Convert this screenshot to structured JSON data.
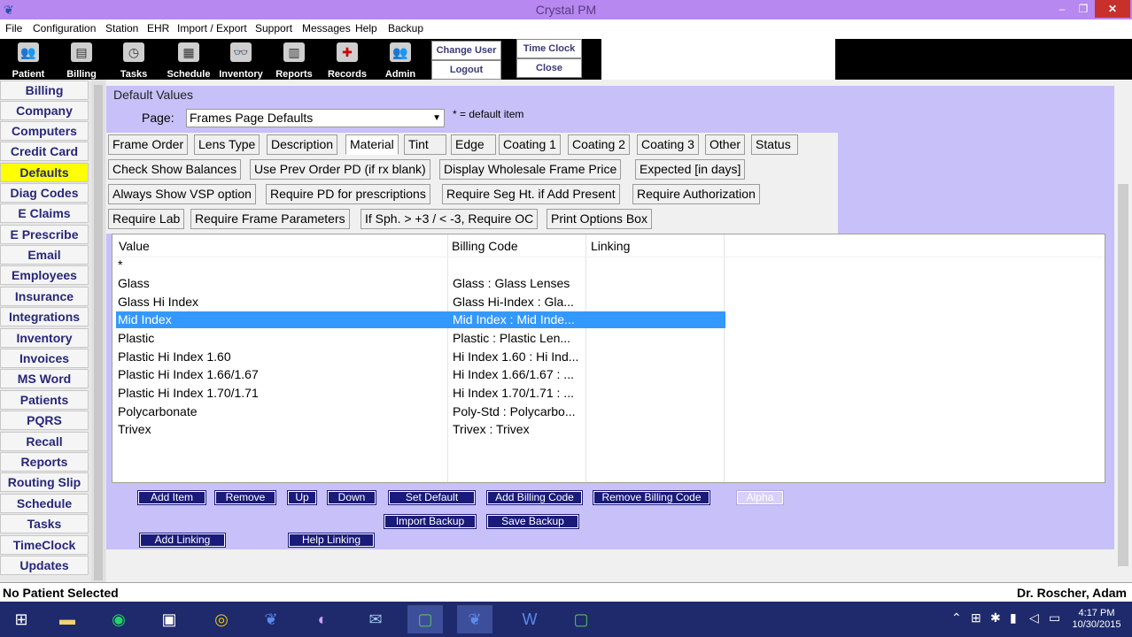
{
  "window": {
    "title": "Crystal PM",
    "minimize": "–",
    "maximize": "❐",
    "close": "✕"
  },
  "menu": [
    "File",
    "Configuration",
    "Station",
    "EHR",
    "Import / Export",
    "Support",
    "Messages",
    "Help",
    "Backup"
  ],
  "toolbar": {
    "tools": [
      "Patient",
      "Billing",
      "Tasks",
      "Schedule",
      "Inventory",
      "Reports",
      "Records",
      "Admin"
    ],
    "change_user": "Change User",
    "logout": "Logout",
    "time_clock": "Time Clock",
    "close": "Close"
  },
  "sidebar": {
    "items": [
      "Billing",
      "Company",
      "Computers",
      "Credit Card",
      "Defaults",
      "Diag Codes",
      "E Claims",
      "E Prescribe",
      "Email",
      "Employees",
      "Insurance",
      "Integrations",
      "Inventory",
      "Invoices",
      "MS Word",
      "Patients",
      "PQRS",
      "Recall",
      "Reports",
      "Routing Slip",
      "Schedule",
      "Tasks",
      "TimeClock",
      "Updates"
    ],
    "active": "Defaults"
  },
  "panel": {
    "title": "Default Values",
    "page_label": "Page:",
    "page_value": "Frames Page Defaults",
    "default_note": "* = default item"
  },
  "options": {
    "row1": [
      "Frame Order",
      "Lens Type",
      "Description",
      "Material",
      "Tint",
      "Edge",
      "Coating 1",
      "Coating 2",
      "Coating 3",
      "Other",
      "Status"
    ],
    "row2": [
      "Check Show Balances",
      "Use Prev Order PD (if rx blank)",
      "Display Wholesale Frame Price",
      "Expected [in days]"
    ],
    "row3": [
      "Always Show VSP option",
      "Require PD for prescriptions",
      "Require Seg Ht. if Add Present",
      "Require Authorization"
    ],
    "row4": [
      "Require Lab",
      "Require Frame Parameters",
      "If Sph. > +3 / < -3, Require OC",
      "Print Options Box"
    ],
    "selected_tab": "Material"
  },
  "table": {
    "headers": {
      "value": "Value",
      "billing": "Billing Code",
      "linking": "Linking"
    },
    "rows": [
      {
        "value": "*",
        "billing": "",
        "linking": ""
      },
      {
        "value": "Glass",
        "billing": "Glass : Glass Lenses",
        "linking": ""
      },
      {
        "value": "Glass Hi Index",
        "billing": "Glass Hi-Index : Gla...",
        "linking": ""
      },
      {
        "value": "Mid Index",
        "billing": "Mid Index : Mid Inde...",
        "linking": ""
      },
      {
        "value": "Plastic",
        "billing": "Plastic : Plastic Len...",
        "linking": ""
      },
      {
        "value": "Plastic Hi Index 1.60",
        "billing": "Hi Index 1.60 : Hi Ind...",
        "linking": ""
      },
      {
        "value": "Plastic Hi Index 1.66/1.67",
        "billing": "Hi Index 1.66/1.67 : ...",
        "linking": ""
      },
      {
        "value": "Plastic Hi Index 1.70/1.71",
        "billing": "Hi Index 1.70/1.71 : ...",
        "linking": ""
      },
      {
        "value": "Polycarbonate",
        "billing": "Poly-Std : Polycarbo...",
        "linking": ""
      },
      {
        "value": "Trivex",
        "billing": "Trivex : Trivex",
        "linking": ""
      }
    ],
    "selected_row": "Mid Index"
  },
  "actions": {
    "add_item": "Add Item",
    "remove": "Remove",
    "up": "Up",
    "down": "Down",
    "set_default": "Set Default",
    "add_billing_code": "Add Billing Code",
    "remove_billing_code": "Remove Billing Code",
    "alpha": "Alpha",
    "import_backup": "Import Backup",
    "save_backup": "Save Backup",
    "add_linking": "Add Linking",
    "help_linking": "Help Linking"
  },
  "status": {
    "patient": "No Patient Selected",
    "doctor": "Dr. Roscher, Adam"
  },
  "taskbar": {
    "time": "4:17 PM",
    "date": "10/30/2015"
  },
  "colors": {
    "titlebar": "#b688f0",
    "panel": "#c8c0f8",
    "selection": "#3399ff",
    "active_sidebar": "#ffff00",
    "action_button": "#1a1a7a"
  }
}
